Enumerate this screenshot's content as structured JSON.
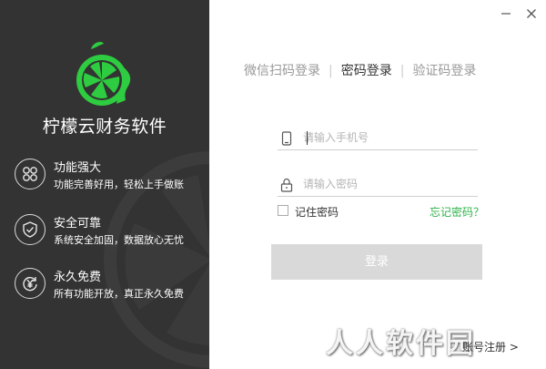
{
  "brand": {
    "name": "柠檬云财务软件"
  },
  "features": [
    {
      "icon": "grid-icon",
      "title": "功能强大",
      "desc": "功能完善好用，轻松上手做账"
    },
    {
      "icon": "shield-icon",
      "title": "安全可靠",
      "desc": "系统安全加固，数据放心无忧"
    },
    {
      "icon": "yuan-refresh-icon",
      "title": "永久免费",
      "desc": "所有功能开放，真正永久免费"
    }
  ],
  "tabs": [
    {
      "label": "微信扫码登录",
      "active": false
    },
    {
      "label": "密码登录",
      "active": true
    },
    {
      "label": "验证码登录",
      "active": false
    }
  ],
  "tab_separator": "|",
  "phone": {
    "placeholder": "请输入手机号",
    "value": ""
  },
  "password": {
    "placeholder": "请输入密码",
    "value": ""
  },
  "remember": {
    "label": "记住密码",
    "checked": false
  },
  "forgot_label": "忘记密码？",
  "login_label": "登录",
  "register_label": "账号注册 >",
  "watermark_text": "人人软件园",
  "colors": {
    "panel": "#333333",
    "accent": "#2eb34a",
    "button_disabled": "#d9d9d9"
  }
}
